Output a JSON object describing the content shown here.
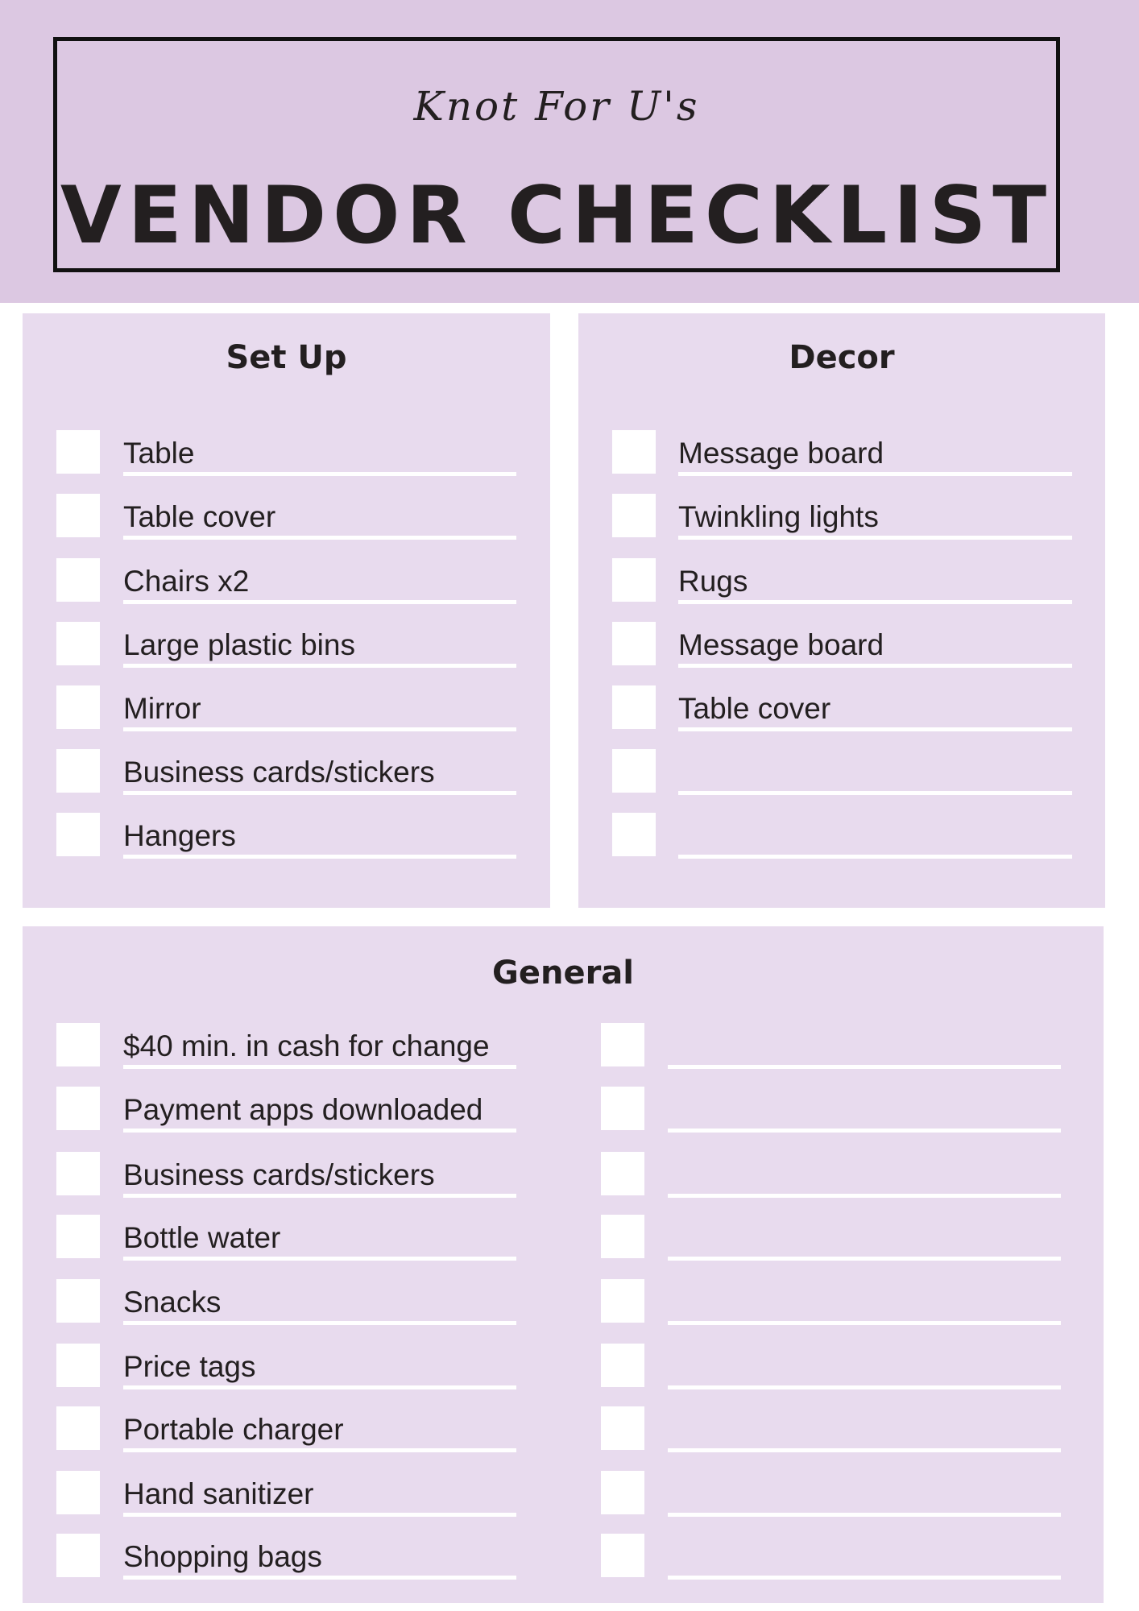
{
  "header": {
    "brand": "Knot For U's",
    "title": "VENDOR CHECKLIST"
  },
  "colors": {
    "header_band": "#dcc8e2",
    "panel": "#e8dbee",
    "checkbox": "#ffffff",
    "text": "#231f20"
  },
  "setup": {
    "heading": "Set Up",
    "items": [
      "Table",
      "Table cover",
      "Chairs x2",
      "Large plastic bins",
      "Mirror",
      "Business cards/stickers",
      "Hangers"
    ]
  },
  "decor": {
    "heading": "Decor",
    "items": [
      "Message board",
      "Twinkling lights",
      "Rugs",
      "Message board",
      "Table cover",
      "",
      ""
    ]
  },
  "general": {
    "heading": "General",
    "items": [
      "$40 min. in cash for change",
      "Payment apps downloaded",
      "Business cards/stickers",
      "Bottle water",
      "Snacks",
      "Price tags",
      "Portable charger",
      "Hand sanitizer",
      "Shopping bags"
    ],
    "extra_items": [
      "",
      "",
      "",
      "",
      "",
      "",
      "",
      "",
      ""
    ]
  }
}
